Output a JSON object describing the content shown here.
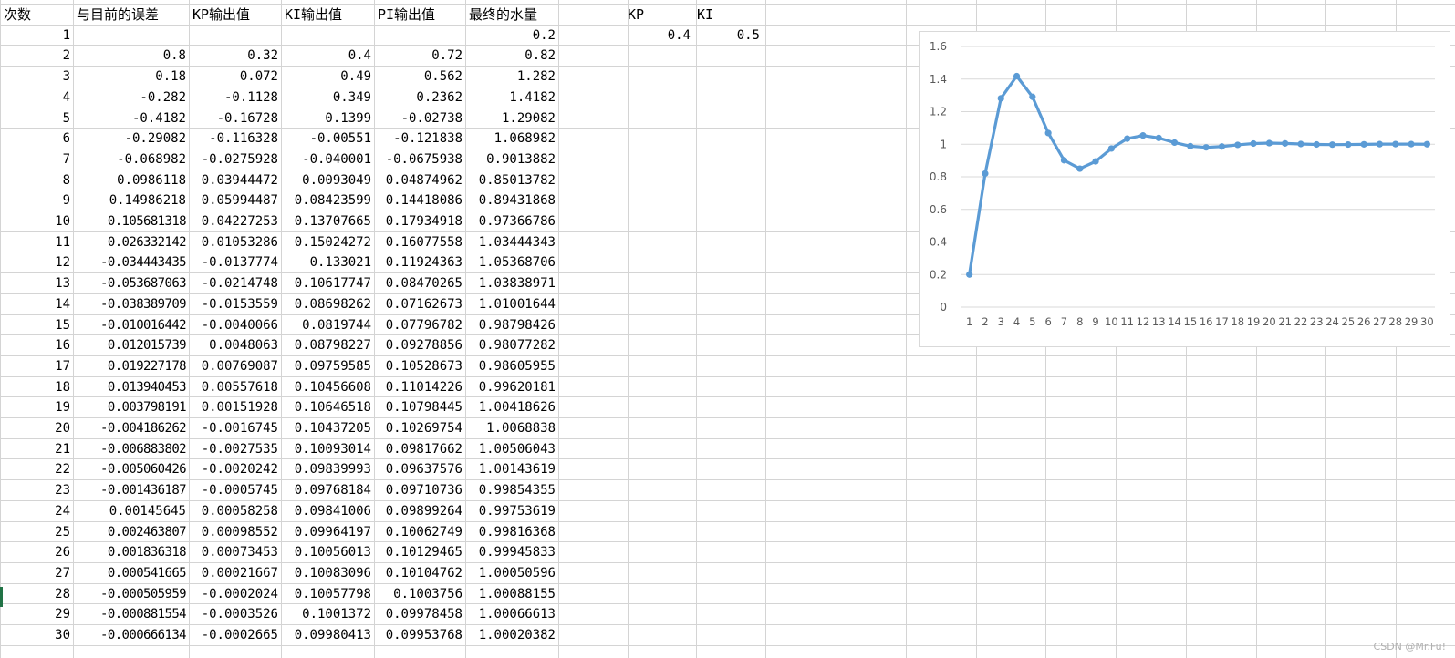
{
  "headers": [
    "次数",
    "与目前的误差",
    "KP输出值",
    "KI输出值",
    "PI输出值",
    "最终的水量"
  ],
  "params": {
    "kp_label": "KP",
    "ki_label": "KI",
    "kp_value": "0.4",
    "ki_value": "0.5"
  },
  "rows": [
    [
      "1",
      "",
      "",
      "",
      "",
      "0.2"
    ],
    [
      "2",
      "0.8",
      "0.32",
      "0.4",
      "0.72",
      "0.82"
    ],
    [
      "3",
      "0.18",
      "0.072",
      "0.49",
      "0.562",
      "1.282"
    ],
    [
      "4",
      "-0.282",
      "-0.1128",
      "0.349",
      "0.2362",
      "1.4182"
    ],
    [
      "5",
      "-0.4182",
      "-0.16728",
      "0.1399",
      "-0.02738",
      "1.29082"
    ],
    [
      "6",
      "-0.29082",
      "-0.116328",
      "-0.00551",
      "-0.121838",
      "1.068982"
    ],
    [
      "7",
      "-0.068982",
      "-0.0275928",
      "-0.040001",
      "-0.0675938",
      "0.9013882"
    ],
    [
      "8",
      "0.0986118",
      "0.03944472",
      "0.0093049",
      "0.04874962",
      "0.85013782"
    ],
    [
      "9",
      "0.14986218",
      "0.05994487",
      "0.08423599",
      "0.14418086",
      "0.89431868"
    ],
    [
      "10",
      "0.105681318",
      "0.04227253",
      "0.13707665",
      "0.17934918",
      "0.97366786"
    ],
    [
      "11",
      "0.026332142",
      "0.01053286",
      "0.15024272",
      "0.16077558",
      "1.03444343"
    ],
    [
      "12",
      "-0.034443435",
      "-0.0137774",
      "0.133021",
      "0.11924363",
      "1.05368706"
    ],
    [
      "13",
      "-0.053687063",
      "-0.0214748",
      "0.10617747",
      "0.08470265",
      "1.03838971"
    ],
    [
      "14",
      "-0.038389709",
      "-0.0153559",
      "0.08698262",
      "0.07162673",
      "1.01001644"
    ],
    [
      "15",
      "-0.010016442",
      "-0.0040066",
      "0.0819744",
      "0.07796782",
      "0.98798426"
    ],
    [
      "16",
      "0.012015739",
      "0.0048063",
      "0.08798227",
      "0.09278856",
      "0.98077282"
    ],
    [
      "17",
      "0.019227178",
      "0.00769087",
      "0.09759585",
      "0.10528673",
      "0.98605955"
    ],
    [
      "18",
      "0.013940453",
      "0.00557618",
      "0.10456608",
      "0.11014226",
      "0.99620181"
    ],
    [
      "19",
      "0.003798191",
      "0.00151928",
      "0.10646518",
      "0.10798445",
      "1.00418626"
    ],
    [
      "20",
      "-0.004186262",
      "-0.0016745",
      "0.10437205",
      "0.10269754",
      "1.0068838"
    ],
    [
      "21",
      "-0.006883802",
      "-0.0027535",
      "0.10093014",
      "0.09817662",
      "1.00506043"
    ],
    [
      "22",
      "-0.005060426",
      "-0.0020242",
      "0.09839993",
      "0.09637576",
      "1.00143619"
    ],
    [
      "23",
      "-0.001436187",
      "-0.0005745",
      "0.09768184",
      "0.09710736",
      "0.99854355"
    ],
    [
      "24",
      "0.00145645",
      "0.00058258",
      "0.09841006",
      "0.09899264",
      "0.99753619"
    ],
    [
      "25",
      "0.002463807",
      "0.00098552",
      "0.09964197",
      "0.10062749",
      "0.99816368"
    ],
    [
      "26",
      "0.001836318",
      "0.00073453",
      "0.10056013",
      "0.10129465",
      "0.99945833"
    ],
    [
      "27",
      "0.000541665",
      "0.00021667",
      "0.10083096",
      "0.10104762",
      "1.00050596"
    ],
    [
      "28",
      "-0.000505959",
      "-0.0002024",
      "0.10057798",
      "0.1003756",
      "1.00088155"
    ],
    [
      "29",
      "-0.000881554",
      "-0.0003526",
      "0.1001372",
      "0.09978458",
      "1.00066613"
    ],
    [
      "30",
      "-0.000666134",
      "-0.0002665",
      "0.09980413",
      "0.09953768",
      "1.00020382"
    ]
  ],
  "chart_data": {
    "type": "line",
    "title": "",
    "xlabel": "",
    "ylabel": "",
    "categories": [
      "1",
      "2",
      "3",
      "4",
      "5",
      "6",
      "7",
      "8",
      "9",
      "10",
      "11",
      "12",
      "13",
      "14",
      "15",
      "16",
      "17",
      "18",
      "19",
      "20",
      "21",
      "22",
      "23",
      "24",
      "25",
      "26",
      "27",
      "28",
      "29",
      "30"
    ],
    "series": [
      {
        "values": [
          0.2,
          0.82,
          1.282,
          1.4182,
          1.29082,
          1.068982,
          0.9013882,
          0.85013782,
          0.89431868,
          0.97366786,
          1.03444343,
          1.05368706,
          1.03838971,
          1.01001644,
          0.98798426,
          0.98077282,
          0.98605955,
          0.99620181,
          1.00418626,
          1.0068838,
          1.00506043,
          1.00143619,
          0.99854355,
          0.99753619,
          0.99816368,
          0.99945833,
          1.00050596,
          1.00088155,
          1.00066613,
          1.00020382
        ],
        "color": "#5b9bd5"
      }
    ],
    "y_ticks": [
      "0",
      "0.2",
      "0.4",
      "0.6",
      "0.8",
      "1",
      "1.2",
      "1.4",
      "1.6"
    ],
    "ylim": [
      0,
      1.6
    ],
    "grid": true,
    "legend": "none",
    "marker": "circle"
  },
  "watermark": "CSDN @Mr.Fu!"
}
